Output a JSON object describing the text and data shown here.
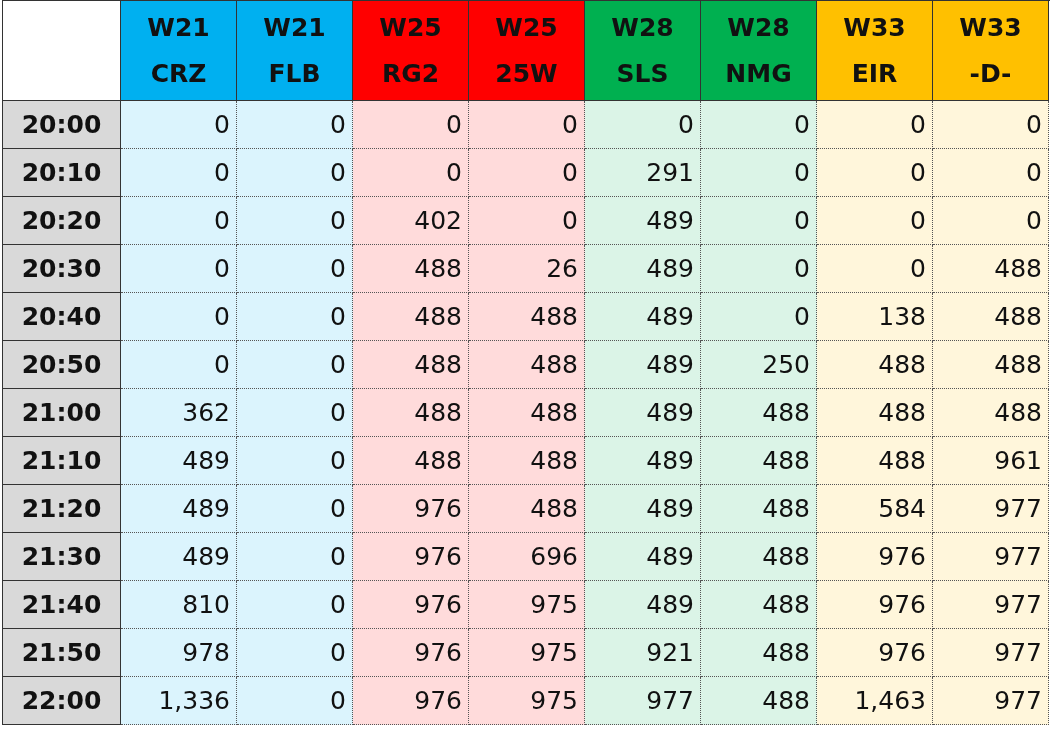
{
  "columns": [
    {
      "week": "W21",
      "code": "CRZ",
      "color": "#00b0f0"
    },
    {
      "week": "W21",
      "code": "FLB",
      "color": "#00b0f0"
    },
    {
      "week": "W25",
      "code": "RG2",
      "color": "#ff0000"
    },
    {
      "week": "W25",
      "code": "25W",
      "color": "#ff0000"
    },
    {
      "week": "W28",
      "code": "SLS",
      "color": "#00b050"
    },
    {
      "week": "W28",
      "code": "NMG",
      "color": "#00b050"
    },
    {
      "week": "W33",
      "code": "EIR",
      "color": "#ffc000"
    },
    {
      "week": "W33",
      "code": "-D-",
      "color": "#ffc000"
    }
  ],
  "rows": [
    {
      "time": "20:00",
      "values": [
        "0",
        "0",
        "0",
        "0",
        "0",
        "0",
        "0",
        "0"
      ]
    },
    {
      "time": "20:10",
      "values": [
        "0",
        "0",
        "0",
        "0",
        "291",
        "0",
        "0",
        "0"
      ]
    },
    {
      "time": "20:20",
      "values": [
        "0",
        "0",
        "402",
        "0",
        "489",
        "0",
        "0",
        "0"
      ]
    },
    {
      "time": "20:30",
      "values": [
        "0",
        "0",
        "488",
        "26",
        "489",
        "0",
        "0",
        "488"
      ]
    },
    {
      "time": "20:40",
      "values": [
        "0",
        "0",
        "488",
        "488",
        "489",
        "0",
        "138",
        "488"
      ]
    },
    {
      "time": "20:50",
      "values": [
        "0",
        "0",
        "488",
        "488",
        "489",
        "250",
        "488",
        "488"
      ]
    },
    {
      "time": "21:00",
      "values": [
        "362",
        "0",
        "488",
        "488",
        "489",
        "488",
        "488",
        "488"
      ]
    },
    {
      "time": "21:10",
      "values": [
        "489",
        "0",
        "488",
        "488",
        "489",
        "488",
        "488",
        "961"
      ]
    },
    {
      "time": "21:20",
      "values": [
        "489",
        "0",
        "976",
        "488",
        "489",
        "488",
        "584",
        "977"
      ]
    },
    {
      "time": "21:30",
      "values": [
        "489",
        "0",
        "976",
        "696",
        "489",
        "488",
        "976",
        "977"
      ]
    },
    {
      "time": "21:40",
      "values": [
        "810",
        "0",
        "976",
        "975",
        "489",
        "488",
        "976",
        "977"
      ]
    },
    {
      "time": "21:50",
      "values": [
        "978",
        "0",
        "976",
        "975",
        "921",
        "488",
        "976",
        "977"
      ]
    },
    {
      "time": "22:00",
      "values": [
        "1,336",
        "0",
        "976",
        "975",
        "977",
        "488",
        "1,463",
        "977"
      ]
    }
  ]
}
